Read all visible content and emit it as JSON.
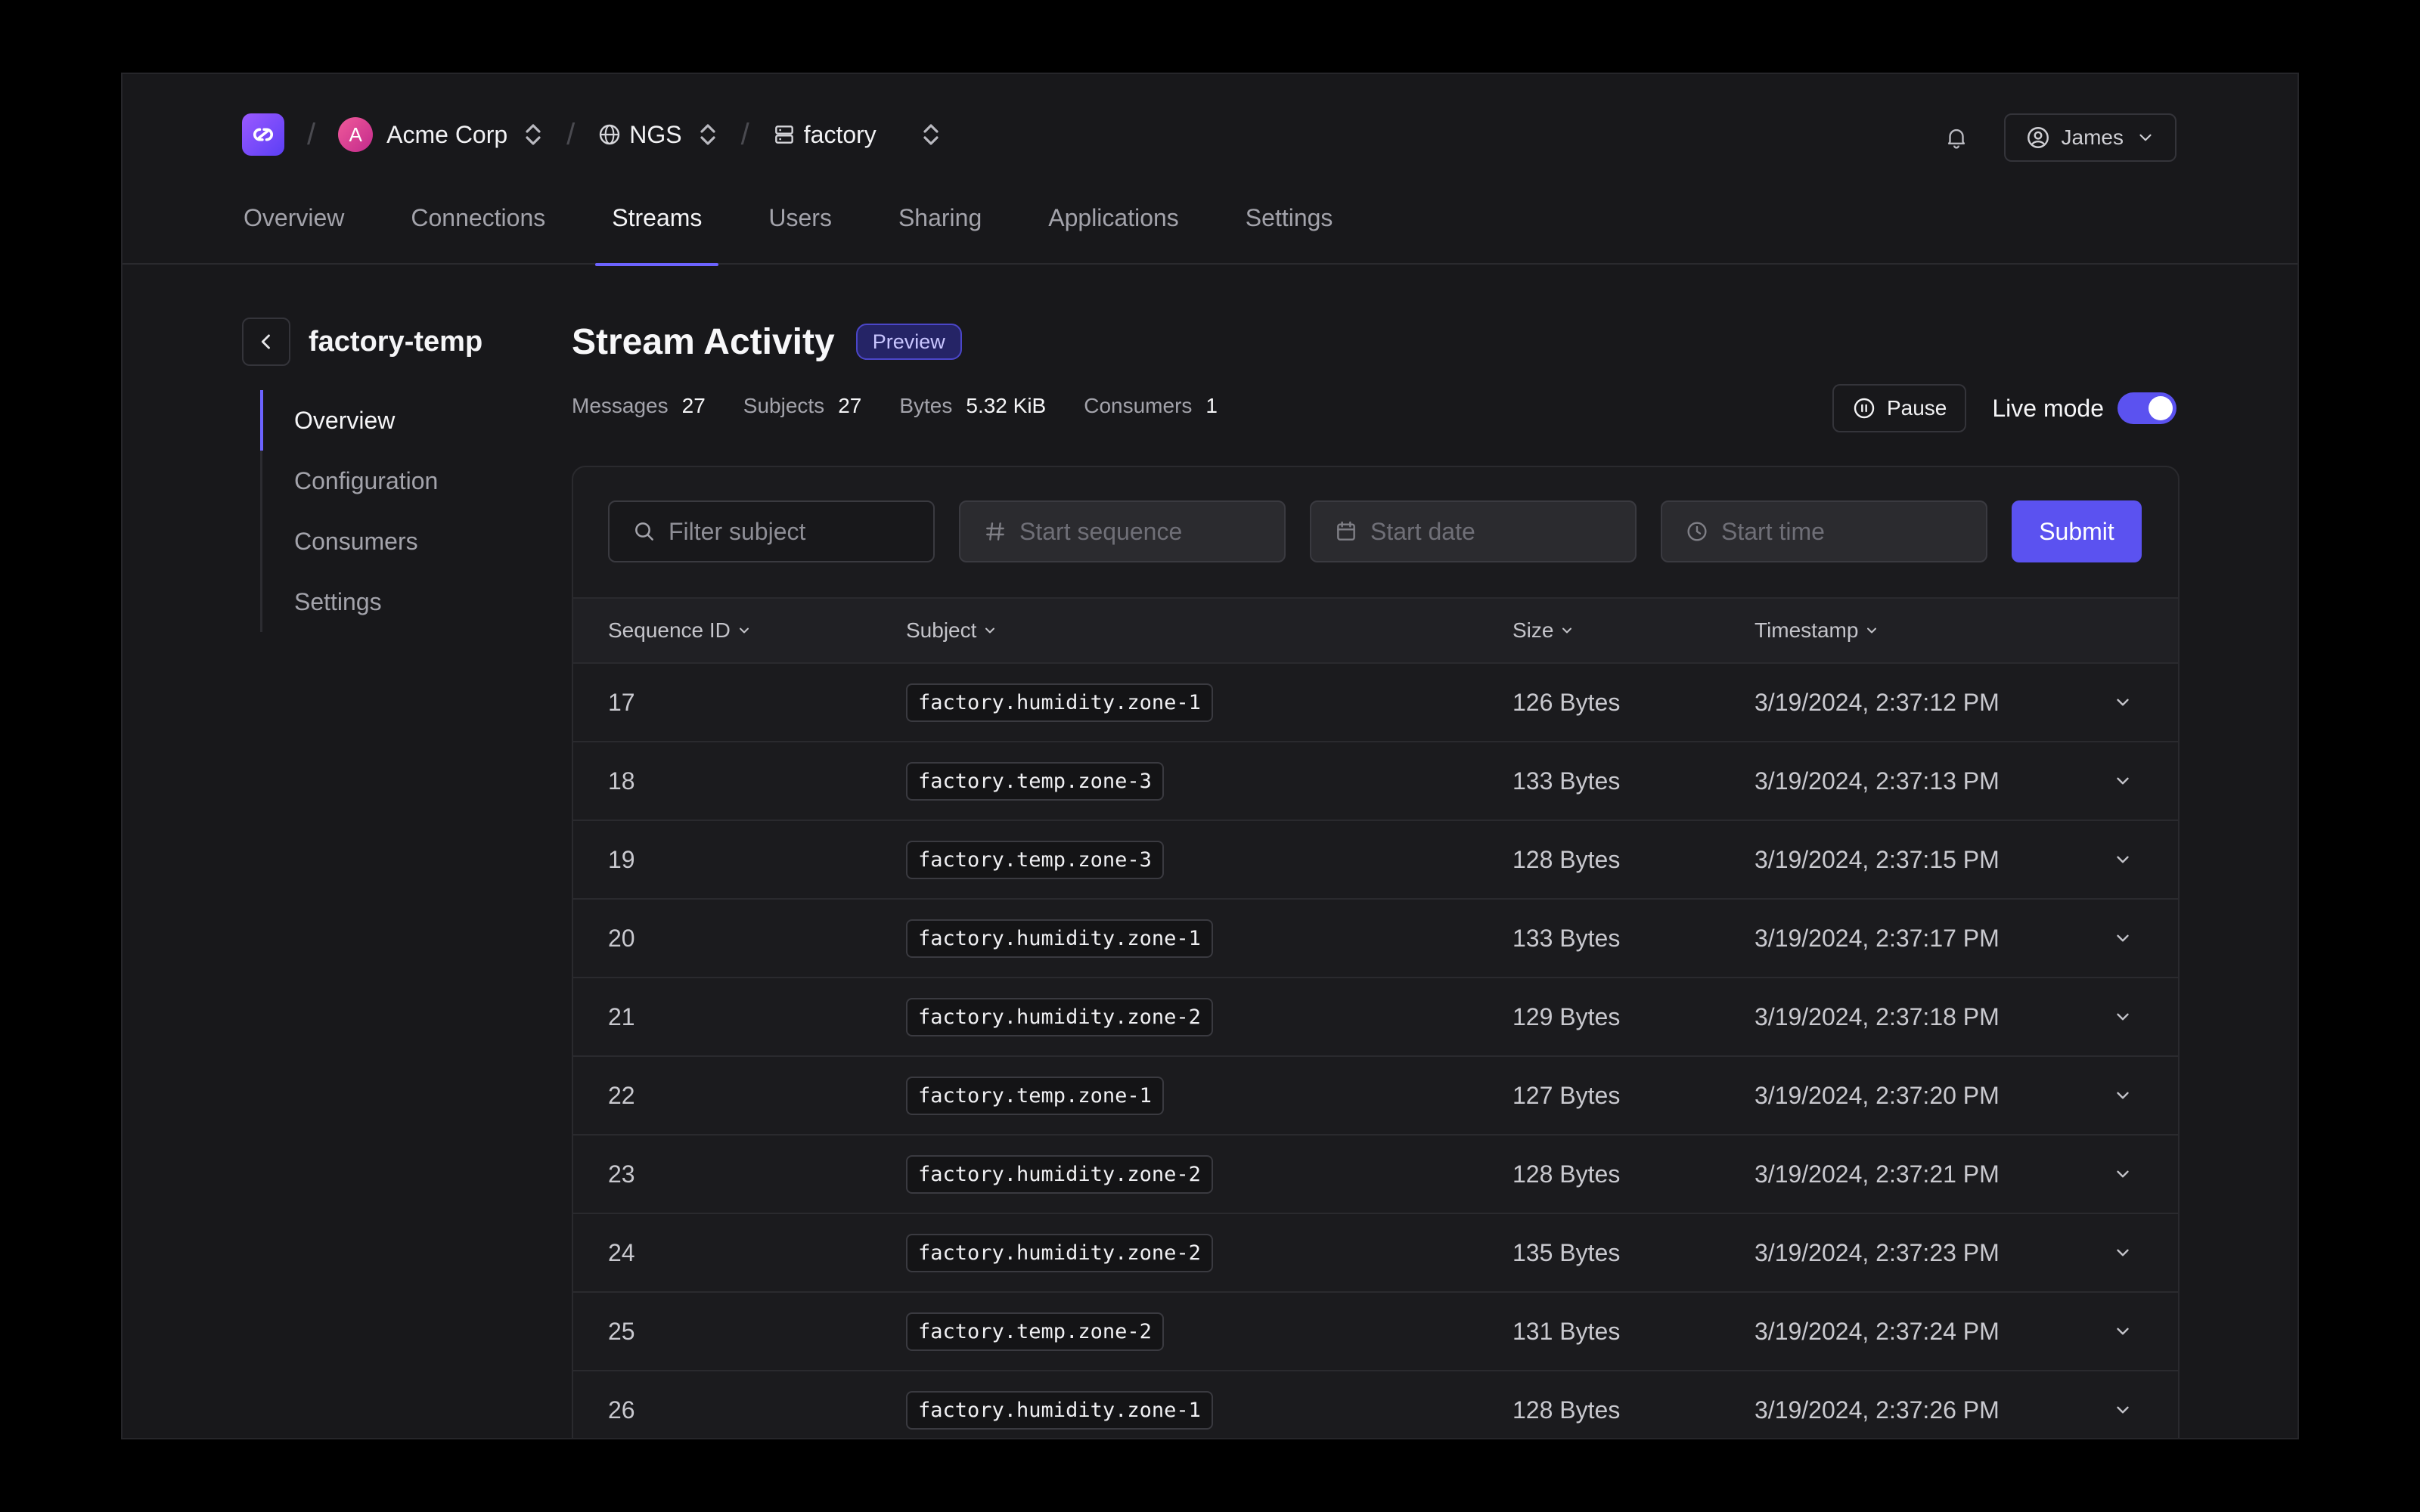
{
  "breadcrumb": {
    "org": {
      "initial": "A",
      "name": "Acme Corp"
    },
    "system": {
      "name": "NGS"
    },
    "account": {
      "name": "factory"
    }
  },
  "user": {
    "name": "James"
  },
  "tabs": [
    {
      "label": "Overview",
      "active": false
    },
    {
      "label": "Connections",
      "active": false
    },
    {
      "label": "Streams",
      "active": true
    },
    {
      "label": "Users",
      "active": false
    },
    {
      "label": "Sharing",
      "active": false
    },
    {
      "label": "Applications",
      "active": false
    },
    {
      "label": "Settings",
      "active": false
    }
  ],
  "sidebar": {
    "stream_name": "factory-temp",
    "items": [
      {
        "label": "Overview",
        "active": true
      },
      {
        "label": "Configuration",
        "active": false
      },
      {
        "label": "Consumers",
        "active": false
      },
      {
        "label": "Settings",
        "active": false
      }
    ]
  },
  "page": {
    "title": "Stream Activity",
    "badge": "Preview",
    "stats": [
      {
        "key": "Messages",
        "value": "27"
      },
      {
        "key": "Subjects",
        "value": "27"
      },
      {
        "key": "Bytes",
        "value": "5.32 KiB"
      },
      {
        "key": "Consumers",
        "value": "1"
      }
    ],
    "pause_label": "Pause",
    "live_mode_label": "Live mode",
    "live_mode_on": true
  },
  "filters": {
    "subject_placeholder": "Filter subject",
    "sequence_placeholder": "Start sequence",
    "date_placeholder": "Start date",
    "time_placeholder": "Start time",
    "submit_label": "Submit"
  },
  "table": {
    "columns": [
      "Sequence ID",
      "Subject",
      "Size",
      "Timestamp"
    ],
    "rows": [
      {
        "seq": "17",
        "subject": "factory.humidity.zone-1",
        "size": "126 Bytes",
        "timestamp": "3/19/2024, 2:37:12 PM"
      },
      {
        "seq": "18",
        "subject": "factory.temp.zone-3",
        "size": "133 Bytes",
        "timestamp": "3/19/2024, 2:37:13 PM"
      },
      {
        "seq": "19",
        "subject": "factory.temp.zone-3",
        "size": "128 Bytes",
        "timestamp": "3/19/2024, 2:37:15 PM"
      },
      {
        "seq": "20",
        "subject": "factory.humidity.zone-1",
        "size": "133 Bytes",
        "timestamp": "3/19/2024, 2:37:17 PM"
      },
      {
        "seq": "21",
        "subject": "factory.humidity.zone-2",
        "size": "129 Bytes",
        "timestamp": "3/19/2024, 2:37:18 PM"
      },
      {
        "seq": "22",
        "subject": "factory.temp.zone-1",
        "size": "127 Bytes",
        "timestamp": "3/19/2024, 2:37:20 PM"
      },
      {
        "seq": "23",
        "subject": "factory.humidity.zone-2",
        "size": "128 Bytes",
        "timestamp": "3/19/2024, 2:37:21 PM"
      },
      {
        "seq": "24",
        "subject": "factory.humidity.zone-2",
        "size": "135 Bytes",
        "timestamp": "3/19/2024, 2:37:23 PM"
      },
      {
        "seq": "25",
        "subject": "factory.temp.zone-2",
        "size": "131 Bytes",
        "timestamp": "3/19/2024, 2:37:24 PM"
      },
      {
        "seq": "26",
        "subject": "factory.humidity.zone-1",
        "size": "128 Bytes",
        "timestamp": "3/19/2024, 2:37:26 PM"
      }
    ]
  },
  "colors": {
    "accent": "#5b52f0",
    "background": "#18181b",
    "page_background": "#000000"
  }
}
